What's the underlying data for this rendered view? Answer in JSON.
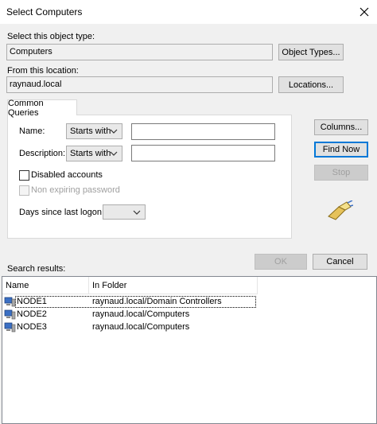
{
  "window": {
    "title": "Select Computers"
  },
  "object_type": {
    "label": "Select this object type:",
    "value": "Computers",
    "button": "Object Types..."
  },
  "location": {
    "label": "From this location:",
    "value": "raynaud.local",
    "button": "Locations..."
  },
  "tab": {
    "label": "Common Queries"
  },
  "queries": {
    "name_label": "Name:",
    "name_mode": "Starts with",
    "name_value": "",
    "description_label": "Description:",
    "description_mode": "Starts with",
    "description_value": "",
    "disabled_accounts": "Disabled accounts",
    "non_expiring_password": "Non expiring password",
    "days_label": "Days since last logon:",
    "days_value": ""
  },
  "side_buttons": {
    "columns": "Columns...",
    "find_now": "Find Now",
    "stop": "Stop"
  },
  "actions": {
    "ok": "OK",
    "cancel": "Cancel"
  },
  "results": {
    "label": "Search results:",
    "columns": [
      "Name",
      "In Folder"
    ],
    "rows": [
      {
        "name": "NODE1",
        "folder": "raynaud.local/Domain Controllers"
      },
      {
        "name": "NODE2",
        "folder": "raynaud.local/Computers"
      },
      {
        "name": "NODE3",
        "folder": "raynaud.local/Computers"
      }
    ]
  },
  "icons": {
    "close": "close-icon",
    "search": "search-flashlight-icon",
    "computer": "computer-icon",
    "dropdown": "chevron-down-icon"
  },
  "colors": {
    "default_button_border": "#0078d7",
    "dialog_bg": "#f0f0f0"
  }
}
